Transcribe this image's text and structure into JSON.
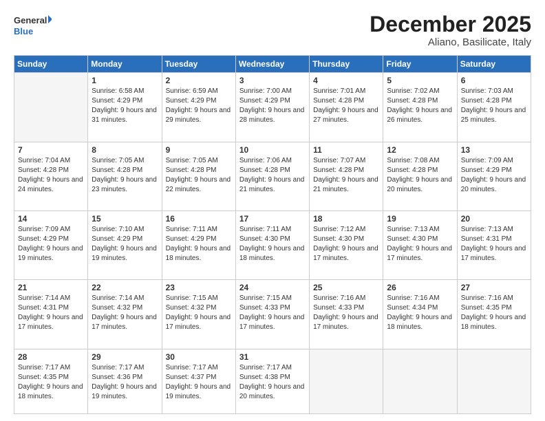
{
  "logo": {
    "general": "General",
    "blue": "Blue"
  },
  "header": {
    "month": "December 2025",
    "location": "Aliano, Basilicate, Italy"
  },
  "weekdays": [
    "Sunday",
    "Monday",
    "Tuesday",
    "Wednesday",
    "Thursday",
    "Friday",
    "Saturday"
  ],
  "weeks": [
    [
      {
        "day": "",
        "empty": true
      },
      {
        "day": "1",
        "sunrise": "6:58 AM",
        "sunset": "4:29 PM",
        "daylight": "9 hours and 31 minutes."
      },
      {
        "day": "2",
        "sunrise": "6:59 AM",
        "sunset": "4:29 PM",
        "daylight": "9 hours and 29 minutes."
      },
      {
        "day": "3",
        "sunrise": "7:00 AM",
        "sunset": "4:29 PM",
        "daylight": "9 hours and 28 minutes."
      },
      {
        "day": "4",
        "sunrise": "7:01 AM",
        "sunset": "4:28 PM",
        "daylight": "9 hours and 27 minutes."
      },
      {
        "day": "5",
        "sunrise": "7:02 AM",
        "sunset": "4:28 PM",
        "daylight": "9 hours and 26 minutes."
      },
      {
        "day": "6",
        "sunrise": "7:03 AM",
        "sunset": "4:28 PM",
        "daylight": "9 hours and 25 minutes."
      }
    ],
    [
      {
        "day": "7",
        "sunrise": "7:04 AM",
        "sunset": "4:28 PM",
        "daylight": "9 hours and 24 minutes."
      },
      {
        "day": "8",
        "sunrise": "7:05 AM",
        "sunset": "4:28 PM",
        "daylight": "9 hours and 23 minutes."
      },
      {
        "day": "9",
        "sunrise": "7:05 AM",
        "sunset": "4:28 PM",
        "daylight": "9 hours and 22 minutes."
      },
      {
        "day": "10",
        "sunrise": "7:06 AM",
        "sunset": "4:28 PM",
        "daylight": "9 hours and 21 minutes."
      },
      {
        "day": "11",
        "sunrise": "7:07 AM",
        "sunset": "4:28 PM",
        "daylight": "9 hours and 21 minutes."
      },
      {
        "day": "12",
        "sunrise": "7:08 AM",
        "sunset": "4:28 PM",
        "daylight": "9 hours and 20 minutes."
      },
      {
        "day": "13",
        "sunrise": "7:09 AM",
        "sunset": "4:29 PM",
        "daylight": "9 hours and 20 minutes."
      }
    ],
    [
      {
        "day": "14",
        "sunrise": "7:09 AM",
        "sunset": "4:29 PM",
        "daylight": "9 hours and 19 minutes."
      },
      {
        "day": "15",
        "sunrise": "7:10 AM",
        "sunset": "4:29 PM",
        "daylight": "9 hours and 19 minutes."
      },
      {
        "day": "16",
        "sunrise": "7:11 AM",
        "sunset": "4:29 PM",
        "daylight": "9 hours and 18 minutes."
      },
      {
        "day": "17",
        "sunrise": "7:11 AM",
        "sunset": "4:30 PM",
        "daylight": "9 hours and 18 minutes."
      },
      {
        "day": "18",
        "sunrise": "7:12 AM",
        "sunset": "4:30 PM",
        "daylight": "9 hours and 17 minutes."
      },
      {
        "day": "19",
        "sunrise": "7:13 AM",
        "sunset": "4:30 PM",
        "daylight": "9 hours and 17 minutes."
      },
      {
        "day": "20",
        "sunrise": "7:13 AM",
        "sunset": "4:31 PM",
        "daylight": "9 hours and 17 minutes."
      }
    ],
    [
      {
        "day": "21",
        "sunrise": "7:14 AM",
        "sunset": "4:31 PM",
        "daylight": "9 hours and 17 minutes."
      },
      {
        "day": "22",
        "sunrise": "7:14 AM",
        "sunset": "4:32 PM",
        "daylight": "9 hours and 17 minutes."
      },
      {
        "day": "23",
        "sunrise": "7:15 AM",
        "sunset": "4:32 PM",
        "daylight": "9 hours and 17 minutes."
      },
      {
        "day": "24",
        "sunrise": "7:15 AM",
        "sunset": "4:33 PM",
        "daylight": "9 hours and 17 minutes."
      },
      {
        "day": "25",
        "sunrise": "7:16 AM",
        "sunset": "4:33 PM",
        "daylight": "9 hours and 17 minutes."
      },
      {
        "day": "26",
        "sunrise": "7:16 AM",
        "sunset": "4:34 PM",
        "daylight": "9 hours and 18 minutes."
      },
      {
        "day": "27",
        "sunrise": "7:16 AM",
        "sunset": "4:35 PM",
        "daylight": "9 hours and 18 minutes."
      }
    ],
    [
      {
        "day": "28",
        "sunrise": "7:17 AM",
        "sunset": "4:35 PM",
        "daylight": "9 hours and 18 minutes."
      },
      {
        "day": "29",
        "sunrise": "7:17 AM",
        "sunset": "4:36 PM",
        "daylight": "9 hours and 19 minutes."
      },
      {
        "day": "30",
        "sunrise": "7:17 AM",
        "sunset": "4:37 PM",
        "daylight": "9 hours and 19 minutes."
      },
      {
        "day": "31",
        "sunrise": "7:17 AM",
        "sunset": "4:38 PM",
        "daylight": "9 hours and 20 minutes."
      },
      {
        "day": "",
        "empty": true
      },
      {
        "day": "",
        "empty": true
      },
      {
        "day": "",
        "empty": true
      }
    ]
  ]
}
